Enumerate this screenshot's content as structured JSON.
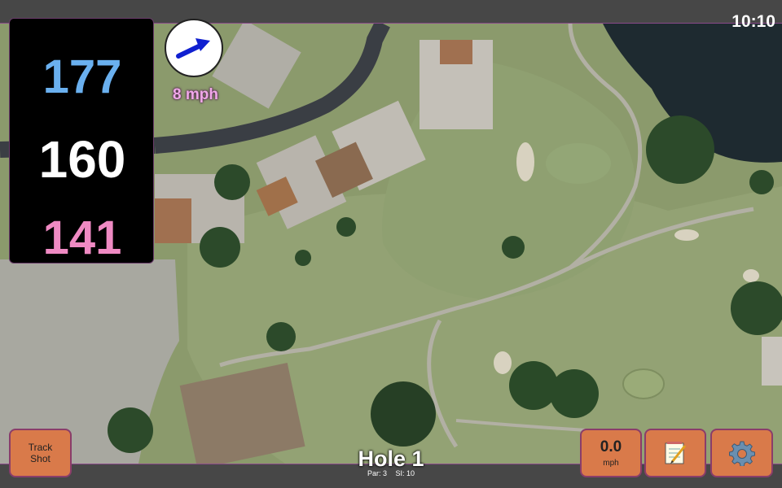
{
  "status": {
    "clock": "10:10"
  },
  "distances": {
    "back": "177",
    "middle": "160",
    "front": "141"
  },
  "wind": {
    "speed": "8 mph",
    "direction": "northeast"
  },
  "buttons": {
    "track_shot": "Track\nShot",
    "speed_value": "0.0",
    "speed_unit": "mph",
    "notes_icon": "notepad-icon",
    "settings_icon": "gear-icon"
  },
  "hole": {
    "title": "Hole 1",
    "par": "Par: 3",
    "si": "SI: 10"
  },
  "colors": {
    "back": "#6ab0ef",
    "middle": "#ffffff",
    "front": "#ef8ac3",
    "wind_text": "#f0a8e8",
    "button": "#d97a4a"
  }
}
